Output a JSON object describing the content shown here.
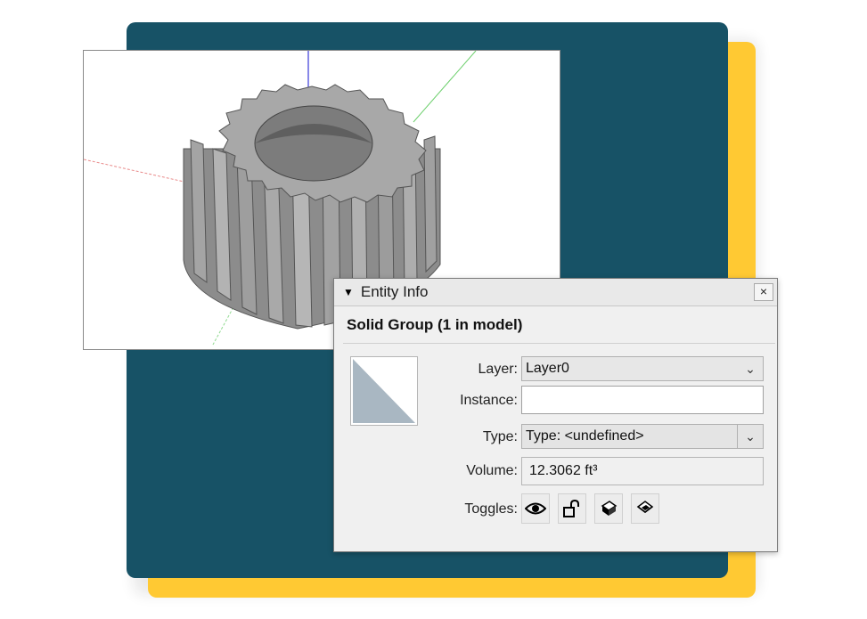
{
  "colors": {
    "teal_card": "#175266",
    "yellow_card": "#ffc933",
    "gear": "#9a9a9a",
    "axis_blue": "#3a3ad8",
    "axis_green": "#6ccf6c",
    "axis_red": "#e98a8a",
    "swatch_fill": "#a9b7c2"
  },
  "panel": {
    "collapse_icon": "triangle-down-icon",
    "title": "Entity Info",
    "close_icon": "close-icon",
    "close_glyph": "×",
    "heading": "Solid Group (1 in model)",
    "layer": {
      "label": "Layer:",
      "value": "Layer0",
      "dropdown_icon": "chevron-down-icon"
    },
    "instance": {
      "label": "Instance:",
      "value": ""
    },
    "type": {
      "label": "Type:",
      "value": "Type: <undefined>",
      "dropdown_icon": "chevron-down-icon"
    },
    "volume": {
      "label": "Volume:",
      "value": "12.3062 ft³"
    },
    "toggles": {
      "label": "Toggles:",
      "icons": [
        "eye-icon",
        "unlock-icon",
        "cast-shadows-icon",
        "receive-shadows-icon"
      ]
    }
  }
}
